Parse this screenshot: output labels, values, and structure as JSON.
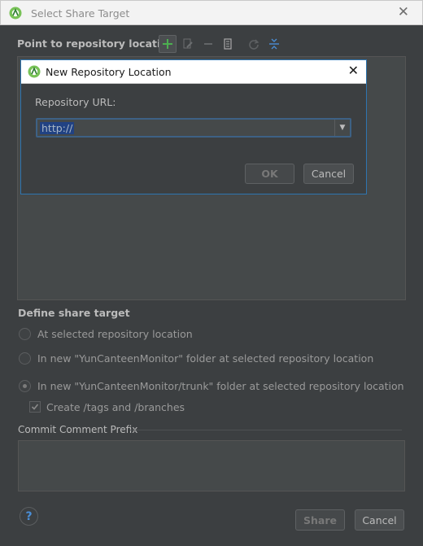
{
  "window": {
    "title": "Select Share Target",
    "app_icon": "android-studio-icon",
    "close_icon": "close-icon"
  },
  "repository_section": {
    "heading": "Point to repository location",
    "toolbar": [
      {
        "name": "add-icon",
        "enabled": true
      },
      {
        "name": "edit-icon",
        "enabled": false
      },
      {
        "name": "remove-icon",
        "enabled": false
      },
      {
        "name": "browse-icon",
        "enabled": true
      },
      {
        "name": "refresh-icon",
        "enabled": false
      },
      {
        "name": "collapse-all-icon",
        "enabled": true
      }
    ]
  },
  "share_target": {
    "heading": "Define share target",
    "options": [
      {
        "label": "At selected repository location",
        "selected": false
      },
      {
        "label": "In new \"YunCanteenMonitor\" folder at selected repository location",
        "selected": false
      },
      {
        "label": "In new \"YunCanteenMonitor/trunk\" folder at selected repository location",
        "selected": true
      }
    ],
    "create_tags_branches": {
      "label": "Create /tags and /branches",
      "checked": true
    }
  },
  "commit": {
    "heading": "Commit Comment Prefix",
    "value": ""
  },
  "buttons": {
    "help": "?",
    "share": "Share",
    "cancel": "Cancel"
  },
  "modal": {
    "title": "New Repository Location",
    "url_label": "Repository URL:",
    "url_value": "http://",
    "ok": "OK",
    "cancel": "Cancel"
  },
  "colors": {
    "accent_green": "#4caf50",
    "selection": "#214283",
    "focus_border": "#2e75b0"
  }
}
